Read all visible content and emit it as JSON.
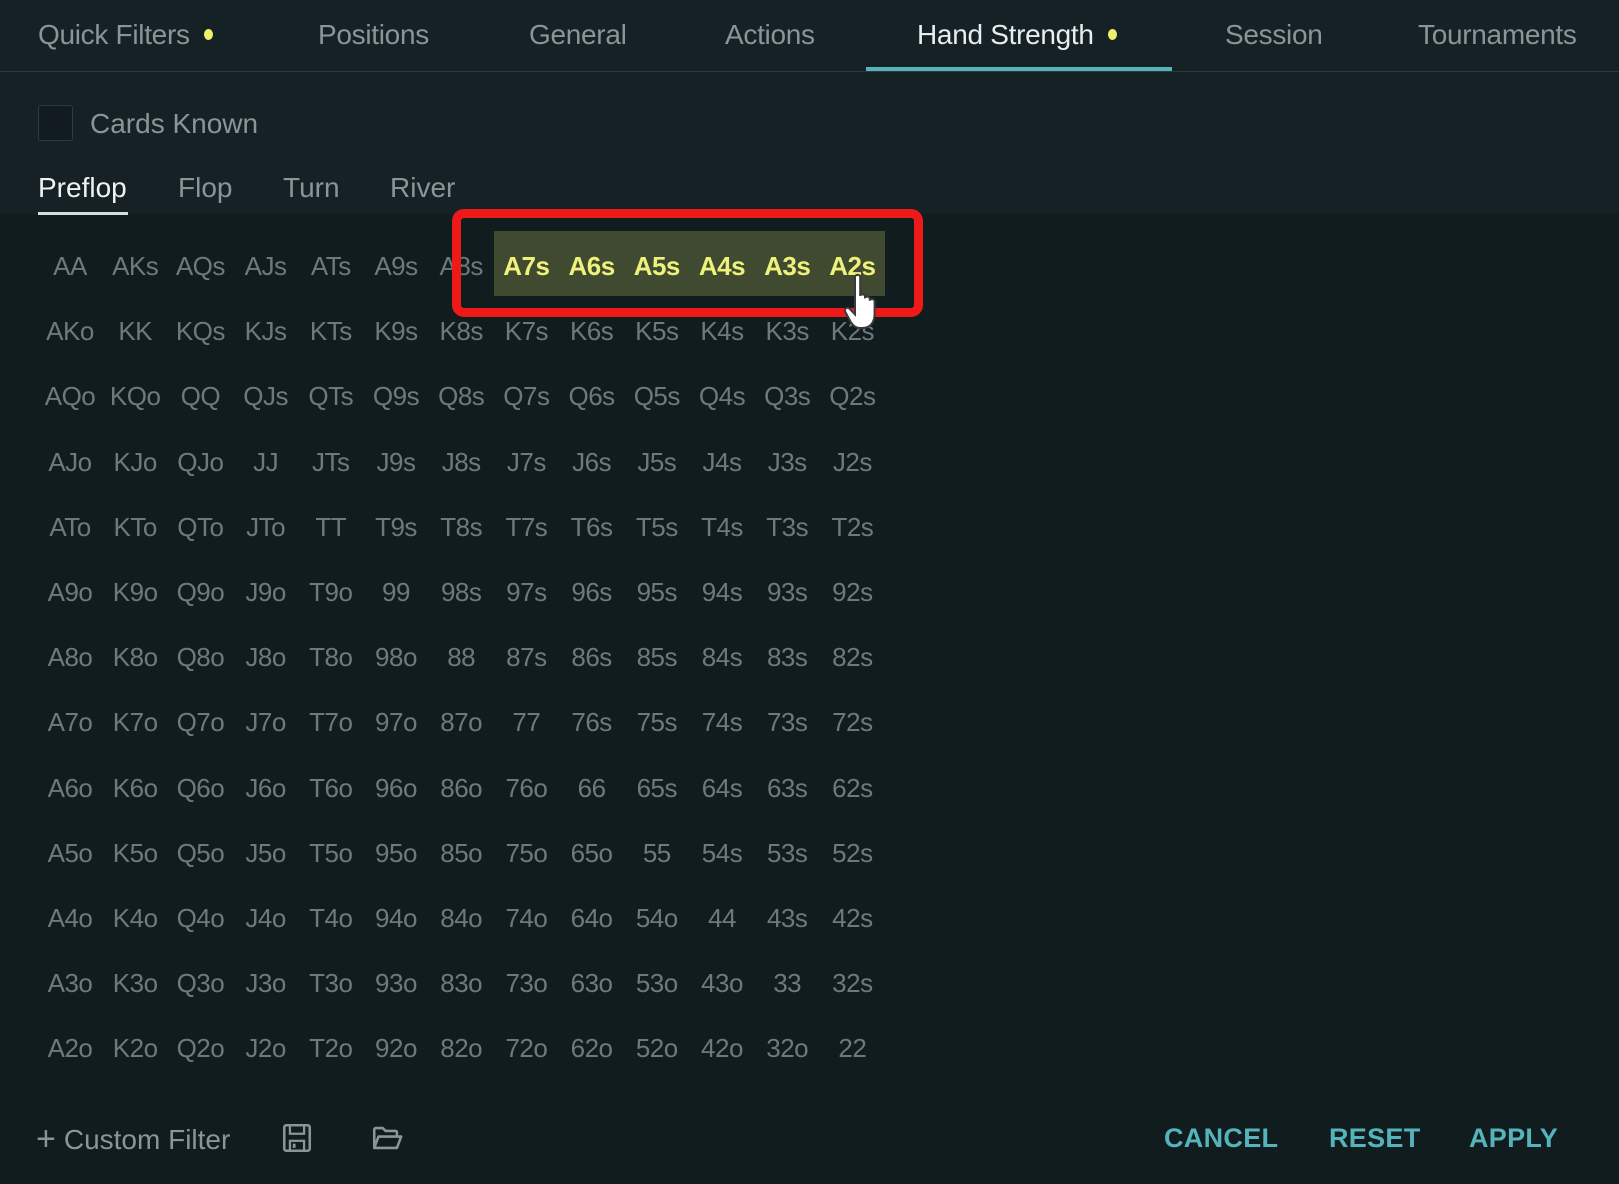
{
  "tabs": [
    {
      "label": "Quick Filters",
      "has_dot": true,
      "active": false
    },
    {
      "label": "Positions",
      "has_dot": false,
      "active": false
    },
    {
      "label": "General",
      "has_dot": false,
      "active": false
    },
    {
      "label": "Actions",
      "has_dot": false,
      "active": false
    },
    {
      "label": "Hand Strength",
      "has_dot": true,
      "active": true
    },
    {
      "label": "Session",
      "has_dot": false,
      "active": false
    },
    {
      "label": "Tournaments",
      "has_dot": false,
      "active": false
    }
  ],
  "cards_known": {
    "label": "Cards Known",
    "checked": false
  },
  "streets": [
    {
      "label": "Preflop",
      "active": true
    },
    {
      "label": "Flop",
      "active": false
    },
    {
      "label": "Turn",
      "active": false
    },
    {
      "label": "River",
      "active": false
    }
  ],
  "hand_grid": {
    "rows": [
      [
        "AA",
        "AKs",
        "AQs",
        "AJs",
        "ATs",
        "A9s",
        "A8s",
        "A7s",
        "A6s",
        "A5s",
        "A4s",
        "A3s",
        "A2s"
      ],
      [
        "AKo",
        "KK",
        "KQs",
        "KJs",
        "KTs",
        "K9s",
        "K8s",
        "K7s",
        "K6s",
        "K5s",
        "K4s",
        "K3s",
        "K2s"
      ],
      [
        "AQo",
        "KQo",
        "QQ",
        "QJs",
        "QTs",
        "Q9s",
        "Q8s",
        "Q7s",
        "Q6s",
        "Q5s",
        "Q4s",
        "Q3s",
        "Q2s"
      ],
      [
        "AJo",
        "KJo",
        "QJo",
        "JJ",
        "JTs",
        "J9s",
        "J8s",
        "J7s",
        "J6s",
        "J5s",
        "J4s",
        "J3s",
        "J2s"
      ],
      [
        "ATo",
        "KTo",
        "QTo",
        "JTo",
        "TT",
        "T9s",
        "T8s",
        "T7s",
        "T6s",
        "T5s",
        "T4s",
        "T3s",
        "T2s"
      ],
      [
        "A9o",
        "K9o",
        "Q9o",
        "J9o",
        "T9o",
        "99",
        "98s",
        "97s",
        "96s",
        "95s",
        "94s",
        "93s",
        "92s"
      ],
      [
        "A8o",
        "K8o",
        "Q8o",
        "J8o",
        "T8o",
        "98o",
        "88",
        "87s",
        "86s",
        "85s",
        "84s",
        "83s",
        "82s"
      ],
      [
        "A7o",
        "K7o",
        "Q7o",
        "J7o",
        "T7o",
        "97o",
        "87o",
        "77",
        "76s",
        "75s",
        "74s",
        "73s",
        "72s"
      ],
      [
        "A6o",
        "K6o",
        "Q6o",
        "J6o",
        "T6o",
        "96o",
        "86o",
        "76o",
        "66",
        "65s",
        "64s",
        "63s",
        "62s"
      ],
      [
        "A5o",
        "K5o",
        "Q5o",
        "J5o",
        "T5o",
        "95o",
        "85o",
        "75o",
        "65o",
        "55",
        "54s",
        "53s",
        "52s"
      ],
      [
        "A4o",
        "K4o",
        "Q4o",
        "J4o",
        "T4o",
        "94o",
        "84o",
        "74o",
        "64o",
        "54o",
        "44",
        "43s",
        "42s"
      ],
      [
        "A3o",
        "K3o",
        "Q3o",
        "J3o",
        "T3o",
        "93o",
        "83o",
        "73o",
        "63o",
        "53o",
        "43o",
        "33",
        "32s"
      ],
      [
        "A2o",
        "K2o",
        "Q2o",
        "J2o",
        "T2o",
        "92o",
        "82o",
        "72o",
        "62o",
        "52o",
        "42o",
        "32o",
        "22"
      ]
    ],
    "selected": [
      "A7s",
      "A6s",
      "A5s",
      "A4s",
      "A3s",
      "A2s"
    ]
  },
  "footer": {
    "custom_filter_label": "Custom Filter",
    "save_icon": "floppy-disk-icon",
    "open_icon": "folder-open-icon",
    "cancel_label": "CANCEL",
    "reset_label": "RESET",
    "apply_label": "APPLY"
  },
  "colors": {
    "accent": "#55b3bb",
    "indicator_dot": "#eef06a",
    "selected_text": "#eef27a",
    "selected_bg": "#3f4a30",
    "annotation_red": "#f01919"
  }
}
